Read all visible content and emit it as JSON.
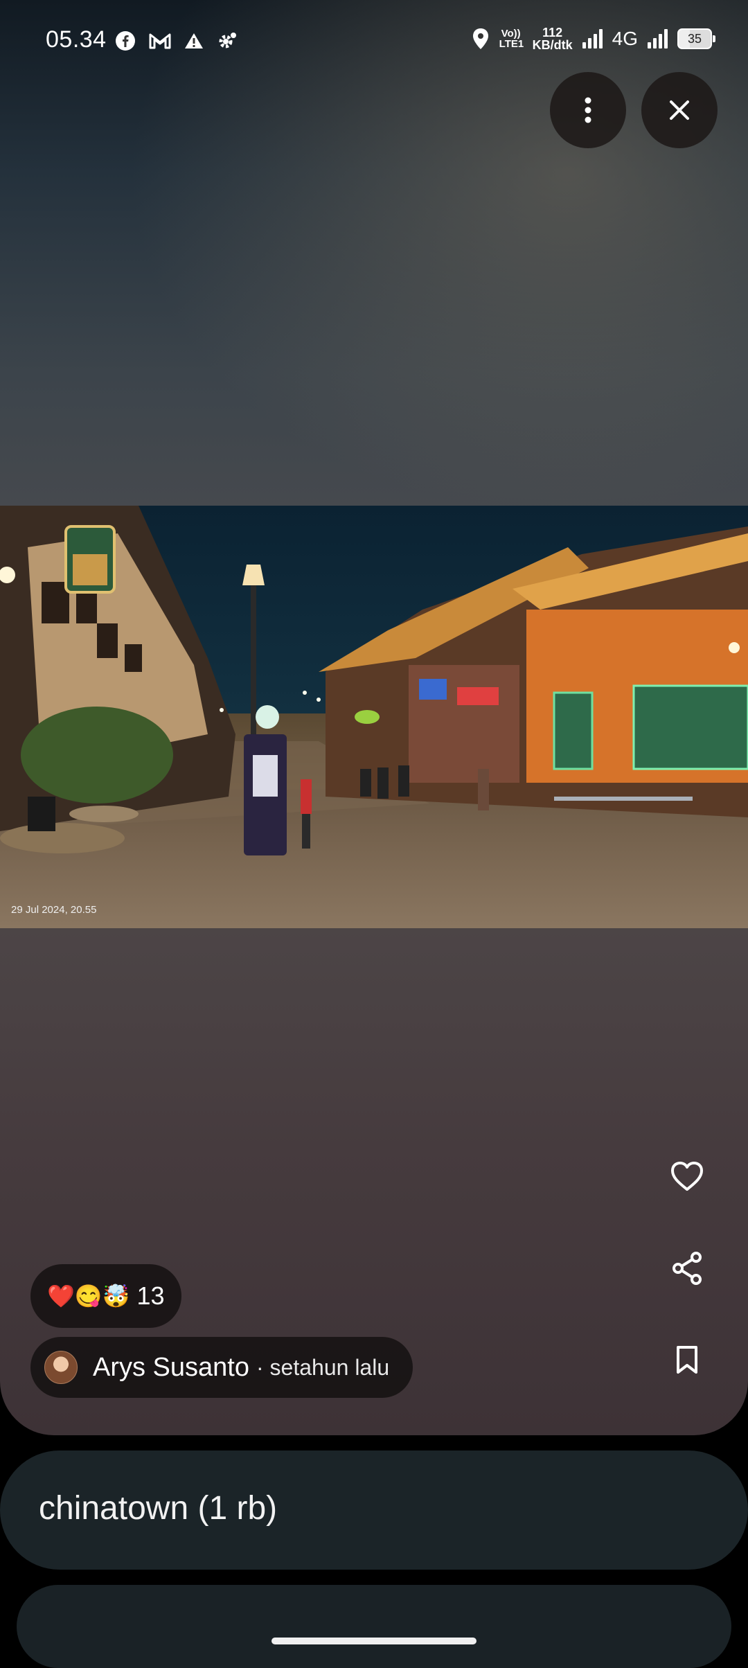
{
  "status_bar": {
    "time": "05.34",
    "network_speed_value": "112",
    "network_speed_unit": "KB/dtk",
    "volte_label": "Vo)) LTE1",
    "network_type": "4G",
    "battery": "35",
    "icons_left": [
      "facebook-icon",
      "gmail-icon",
      "warning-icon",
      "settings-gear-icon"
    ],
    "icons_right": [
      "location-icon",
      "signal-icon",
      "signal-icon",
      "battery-icon"
    ]
  },
  "top_actions": {
    "more_icon": "more-vertical-icon",
    "close_icon": "close-icon"
  },
  "photo": {
    "date_stamp": "29 Jul 2024, 20.55"
  },
  "side_actions": [
    "heart-icon",
    "share-icon",
    "bookmark-icon"
  ],
  "reactions": {
    "emojis": "❤️😋🤯",
    "count": "13"
  },
  "author": {
    "name": "Arys Susanto",
    "separator": " · ",
    "time": "setahun lalu"
  },
  "topic_chip": {
    "label": "chinatown (1 rb)"
  }
}
